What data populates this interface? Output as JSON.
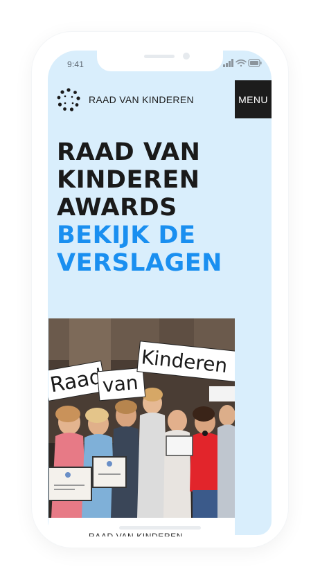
{
  "status_bar": {
    "time": "9:41"
  },
  "header": {
    "brand_name": "RAAD VAN KINDEREN",
    "menu_label": "MENU",
    "logo_icon": "dotted-circle-logo-icon"
  },
  "hero": {
    "title_lines": [
      "RAAD VAN",
      "KINDEREN",
      "AWARDS"
    ],
    "subtitle_lines": [
      "BEKIJK DE",
      "VERSLAGEN"
    ]
  },
  "photo": {
    "sign_words": [
      "Raad",
      "van",
      "Kinderen"
    ]
  },
  "footer": {
    "partial_text": "RAAD VAN KINDEREN"
  },
  "colors": {
    "background": "#d9eefc",
    "accent_blue": "#1a8ff0",
    "dark": "#1a1a1a",
    "menu_bg": "#1c1c1c"
  }
}
